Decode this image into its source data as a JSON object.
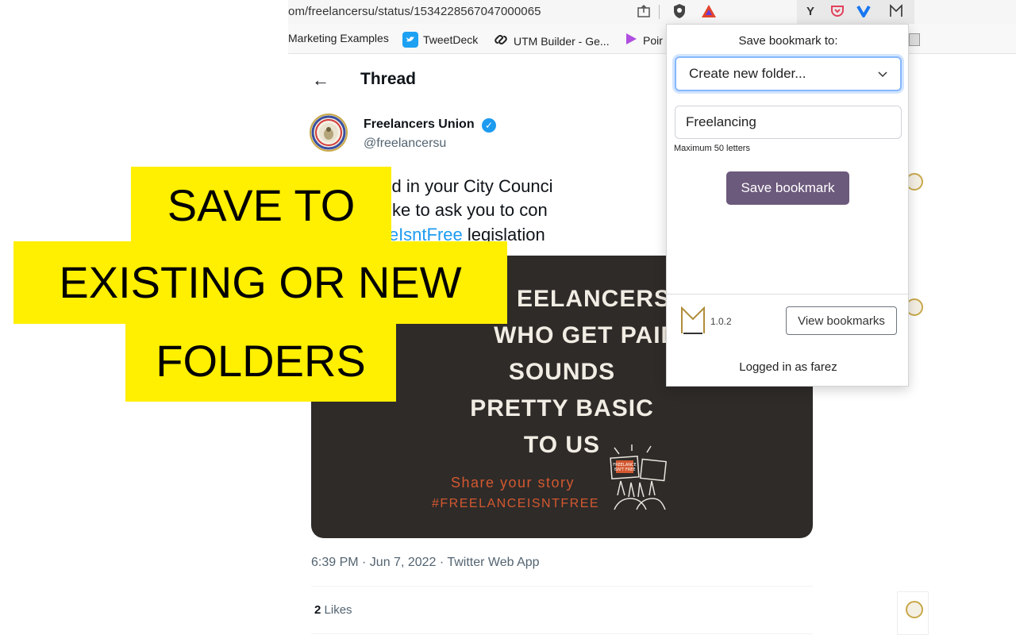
{
  "browser": {
    "url": "om/freelancersu/status/1534228567047000065",
    "bookmarks": [
      {
        "label": "Marketing Examples",
        "icon": "none"
      },
      {
        "label": "TweetDeck",
        "icon": "tweetdeck-icon"
      },
      {
        "label": "UTM Builder - Ge...",
        "icon": "link-icon"
      },
      {
        "label": "Poir",
        "icon": "play-arrow-icon"
      }
    ]
  },
  "thread": {
    "title": "Thread",
    "author_name": "Freelancers Union",
    "author_handle": "@freelancersu",
    "text_line1": "e you voted in your City Counci",
    "text_line2": "ting we'd like to ask you to con",
    "hashtag": "#FreelanceIsntFree",
    "text_line3_rest": "legislation",
    "timestamp": "6:39 PM · Jun 7, 2022 · Twitter Web App",
    "likes_count": "2",
    "likes_label": "Likes"
  },
  "media": {
    "line1": "EELANCERS",
    "line2": "WHO GET PAID..",
    "line3": "SOUNDS",
    "line4": "PRETTY BASIC",
    "line5": "TO US",
    "share": "Share your story",
    "hashtag": "#FREELANCEISNTFREE",
    "sign_text": "FREELANCE ISN'T FREE"
  },
  "popup": {
    "title": "Save bookmark to:",
    "select_value": "Create new folder...",
    "input_value": "Freelancing",
    "hint": "Maximum 50 letters",
    "save_label": "Save bookmark",
    "version": "1.0.2",
    "view_label": "View bookmarks",
    "logged_in": "Logged in as farez"
  },
  "overlay": {
    "line1": "SAVE TO",
    "line2": "EXISTING OR NEW",
    "line3": "FOLDERS"
  },
  "colors": {
    "twitter_blue": "#1d9bf0",
    "save_button": "#6c5a7c",
    "overlay_yellow": "#ffef00",
    "media_bg": "#2e2b29"
  }
}
